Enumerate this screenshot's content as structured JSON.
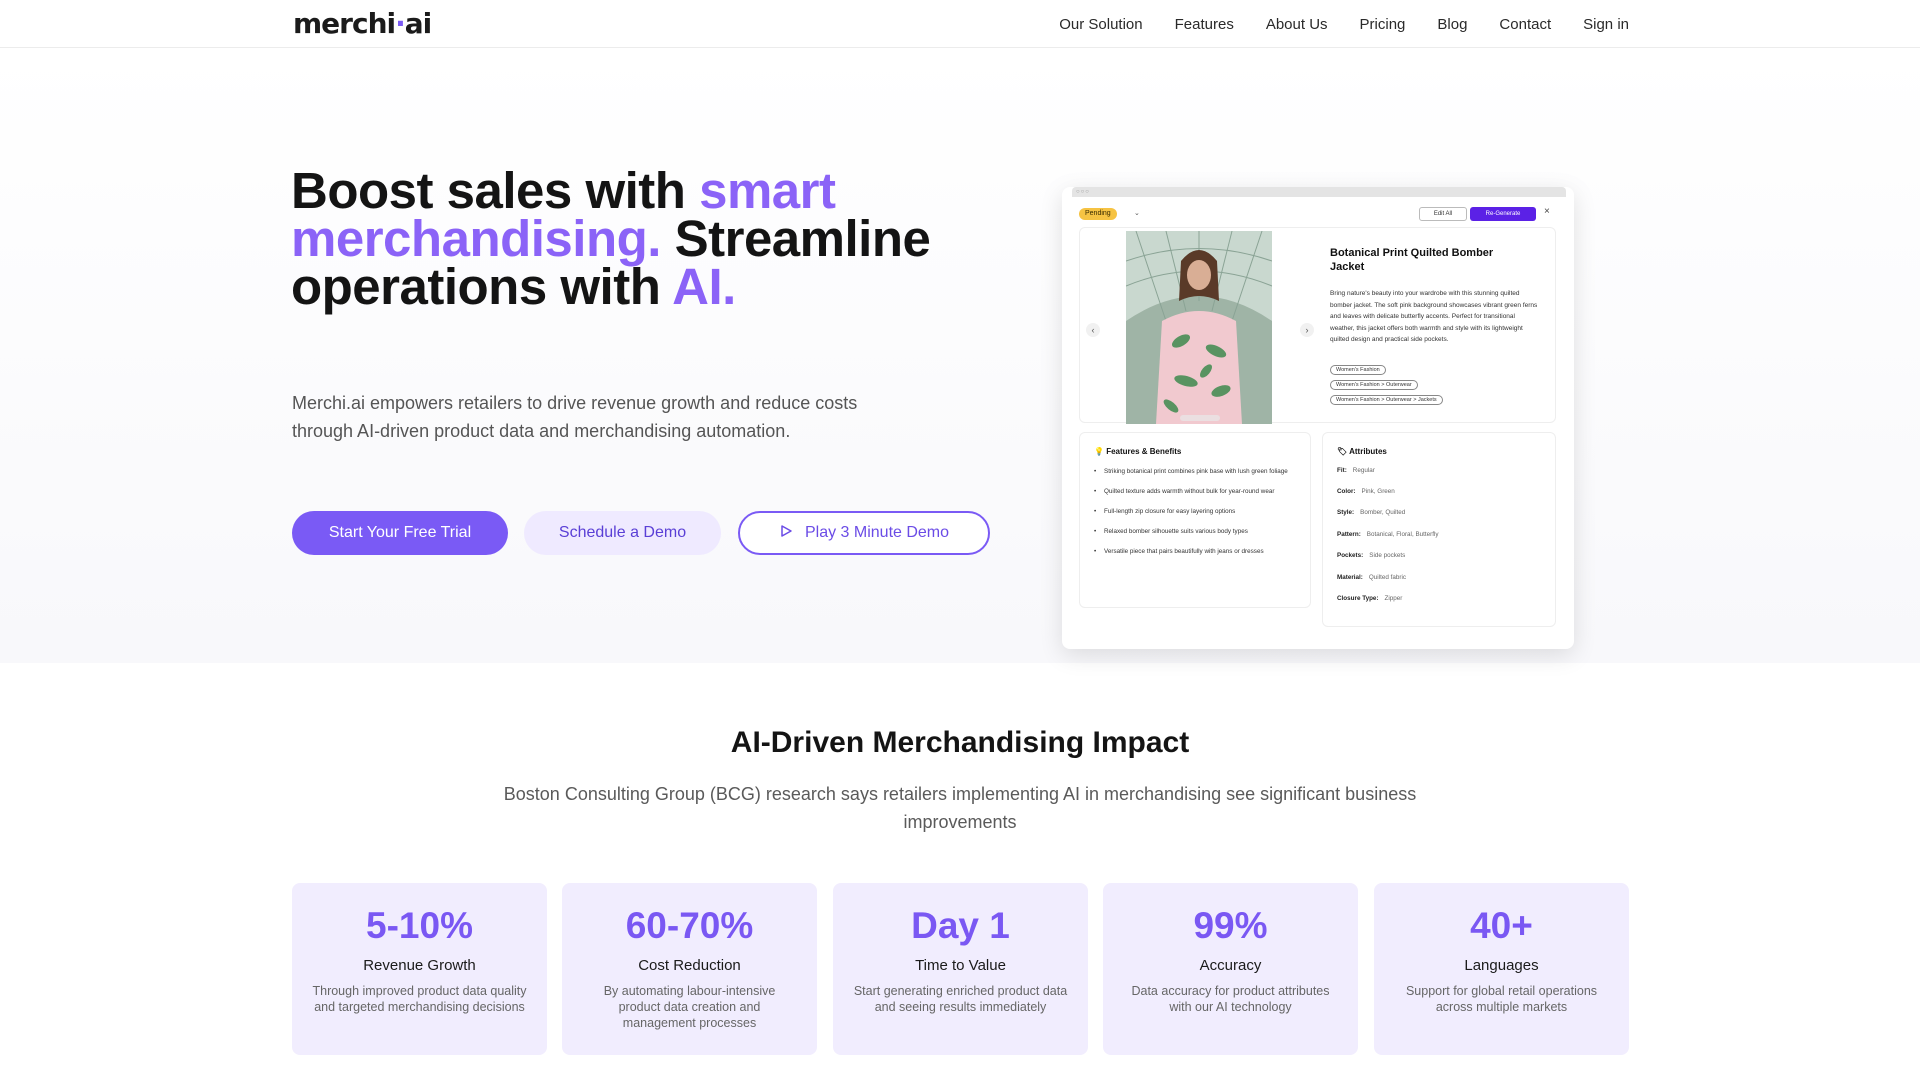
{
  "brand": {
    "logo_main": "merchi",
    "logo_dot": "·",
    "logo_tail": "ai",
    "accent_color": "#7a5af5"
  },
  "nav": {
    "items": [
      "Our Solution",
      "Features",
      "About Us",
      "Pricing",
      "Blog",
      "Contact",
      "Sign in"
    ]
  },
  "hero": {
    "title_1": "Boost sales with ",
    "title_accent_1": "smart merchandising.",
    "title_2": " Streamline operations with ",
    "title_accent_2": "AI.",
    "subtitle": "Merchi.ai empowers retailers to drive revenue growth and reduce costs through AI-driven product data and merchandising automation.",
    "cta_primary": "Start Your Free Trial",
    "cta_secondary": "Schedule a Demo",
    "cta_video": "Play 3 Minute Demo"
  },
  "mock": {
    "status": "Pending",
    "edit_label": "Edit All",
    "regen_label": "Re-Generate",
    "product_title": "Botanical Print Quilted Bomber Jacket",
    "product_desc": "Bring nature's beauty into your wardrobe with this stunning quilted bomber jacket. The soft pink background showcases vibrant green ferns and leaves with delicate butterfly accents. Perfect for transitional weather, this jacket offers both warmth and style with its lightweight quilted design and practical side pockets.",
    "categories": [
      "Women's Fashion",
      "Women's Fashion > Outerwear",
      "Women's Fashion > Outerwear > Jackets"
    ],
    "features_title": "Features & Benefits",
    "features": [
      "Striking botanical print combines pink base with lush green foliage",
      "Quilted texture adds warmth without bulk for year-round wear",
      "Full-length zip closure for easy layering options",
      "Relaxed bomber silhouette suits various body types",
      "Versatile piece that pairs beautifully with jeans or dresses"
    ],
    "attributes_title": "Attributes",
    "attributes": [
      {
        "k": "Fit:",
        "v": "Regular"
      },
      {
        "k": "Color:",
        "v": "Pink, Green"
      },
      {
        "k": "Style:",
        "v": "Bomber, Quilted"
      },
      {
        "k": "Pattern:",
        "v": "Botanical, Floral, Butterfly"
      },
      {
        "k": "Pockets:",
        "v": "Side pockets"
      },
      {
        "k": "Material:",
        "v": "Quilted fabric"
      },
      {
        "k": "Closure Type:",
        "v": "Zipper"
      }
    ]
  },
  "impact": {
    "title": "AI-Driven Merchandising Impact",
    "subtitle": "Boston Consulting Group (BCG) research says retailers implementing AI in merchandising see significant business improvements",
    "stats": [
      {
        "value": "5-10%",
        "label": "Revenue Growth",
        "desc": "Through improved product data quality and targeted merchandising decisions"
      },
      {
        "value": "60-70%",
        "label": "Cost Reduction",
        "desc": "By automating labour-intensive product data creation and management processes"
      },
      {
        "value": "Day 1",
        "label": "Time to Value",
        "desc": "Start generating enriched product data and seeing results immediately"
      },
      {
        "value": "99%",
        "label": "Accuracy",
        "desc": "Data accuracy for product attributes with our AI technology"
      },
      {
        "value": "40+",
        "label": "Languages",
        "desc": "Support for global retail operations across multiple markets"
      }
    ]
  }
}
